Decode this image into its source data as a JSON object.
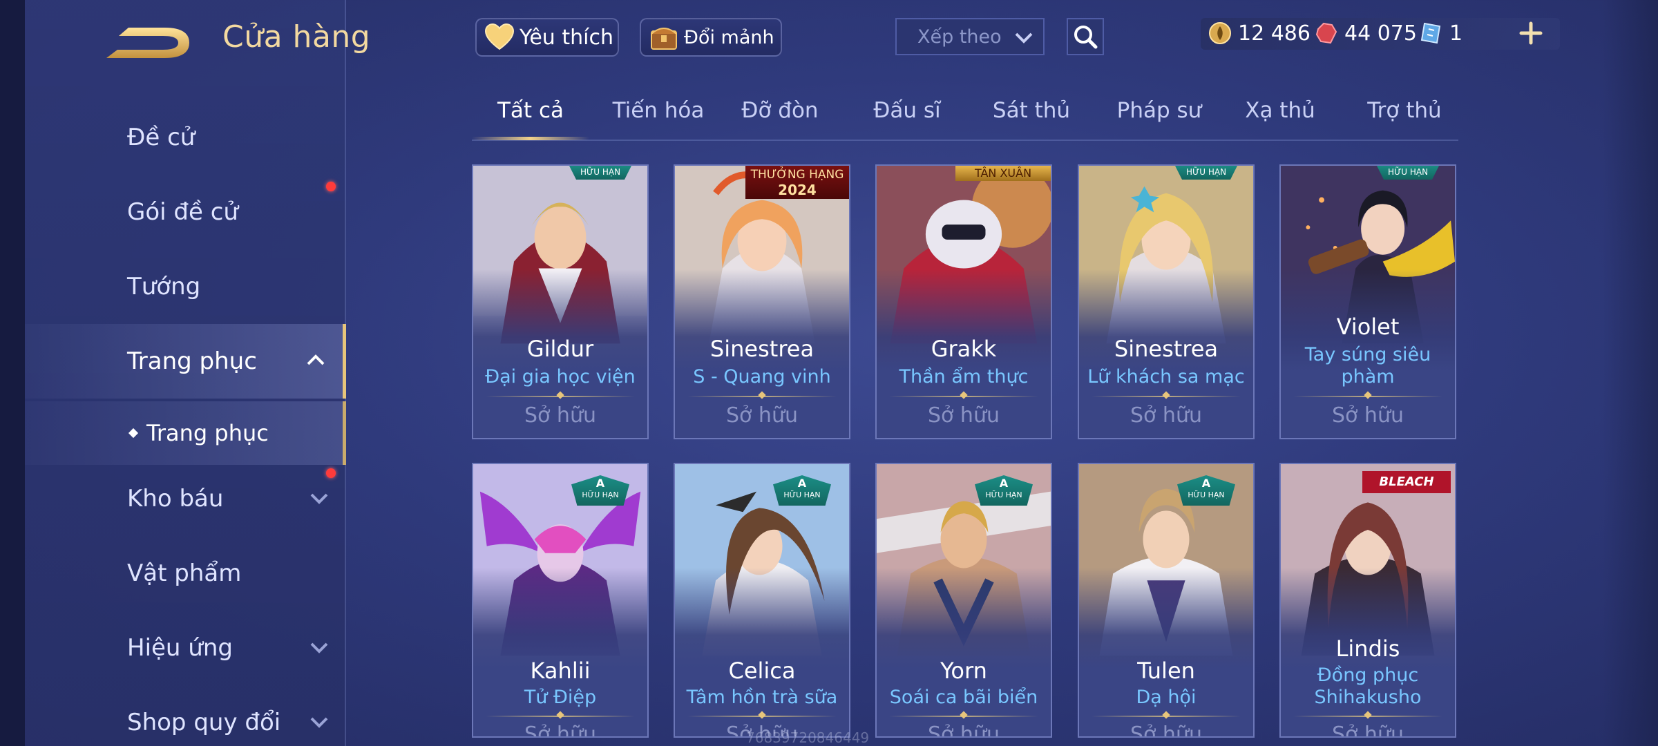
{
  "header": {
    "title": "Cửa hàng",
    "favorites_label": "Yêu thích",
    "exchange_label": "Đổi mảnh",
    "sort_placeholder": "Xếp theo"
  },
  "currency": {
    "coins": "12 486",
    "gems": "44 075",
    "vouchers": "1"
  },
  "sidebar": {
    "items": [
      {
        "label": "Đề cử"
      },
      {
        "label": "Gói đề cử"
      },
      {
        "label": "Tướng"
      },
      {
        "label": "Trang phục"
      },
      {
        "label": "Kho báu"
      },
      {
        "label": "Vật phẩm"
      },
      {
        "label": "Hiệu ứng"
      },
      {
        "label": "Shop quy đổi"
      }
    ],
    "subitem": "Trang phục"
  },
  "tabs": [
    "Tất cả",
    "Tiến hóa",
    "Đỡ đòn",
    "Đấu sĩ",
    "Sát thủ",
    "Pháp sư",
    "Xạ thủ",
    "Trợ thủ"
  ],
  "cards": [
    {
      "hero": "Gildur",
      "skin": "Đại gia học viện",
      "status": "Sở hữu",
      "badge": "HỮU HẠN"
    },
    {
      "hero": "Sinestrea",
      "skin": "S - Quang vinh",
      "status": "Sở hữu",
      "ribbon_line1": "THƯỞNG HẠNG",
      "ribbon_line2": "2024"
    },
    {
      "hero": "Grakk",
      "skin": "Thần ẩm thực",
      "status": "Sở hữu",
      "tag": "TÂN XUÂN"
    },
    {
      "hero": "Sinestrea",
      "skin": "Lữ khách sa mạc",
      "status": "Sở hữu",
      "badge": "HỮU HẠN"
    },
    {
      "hero": "Violet",
      "skin_line1": "Tay súng siêu",
      "skin_line2": "phàm",
      "status": "Sở hữu",
      "badge": "HỮU HẠN"
    },
    {
      "hero": "Kahlii",
      "skin": "Tử Điệp",
      "status": "Sở hữu",
      "badge_grade": "A",
      "badge_text": "HỮU HẠN"
    },
    {
      "hero": "Celica",
      "skin": "Tâm hồn trà sữa",
      "status": "Sở hữu",
      "badge_grade": "A",
      "badge_text": "HỮU HẠN"
    },
    {
      "hero": "Yorn",
      "skin": "Soái ca bãi biển",
      "status": "Sở hữu",
      "badge_grade": "A",
      "badge_text": "HỮU HẠN"
    },
    {
      "hero": "Tulen",
      "skin": "Dạ hội",
      "status": "Sở hữu",
      "badge_grade": "A",
      "badge_text": "HỮU HẠN"
    },
    {
      "hero": "Lindis",
      "skin_line1": "Đồng phục",
      "skin_line2": "Shihakusho",
      "status": "Sở hữu",
      "tag": "BLEACH"
    }
  ],
  "watermark": "76839720846449",
  "colors": {
    "accent_gold": "#e7c57b",
    "skin_text": "#79c7ff",
    "background": "#2f3a7c"
  }
}
